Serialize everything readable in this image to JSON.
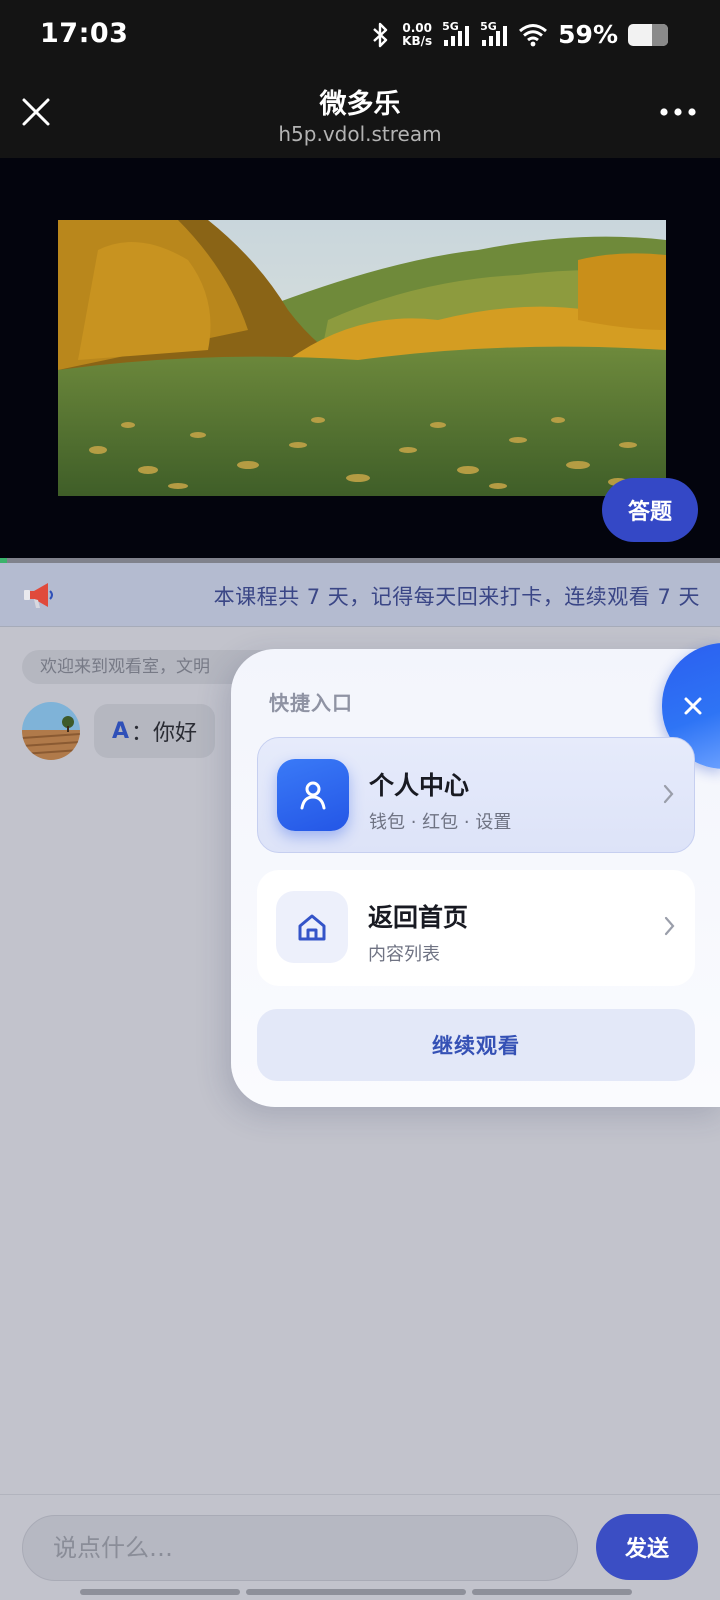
{
  "status_bar": {
    "time": "17:03",
    "net_speed_value": "0.00",
    "net_speed_unit": "KB/s",
    "signal1_tag": "5G",
    "signal2_tag": "5G",
    "battery": "59%",
    "battery_level": 0.59,
    "icons": [
      "bluetooth-icon",
      "signal-icon",
      "wifi-icon",
      "battery-icon"
    ]
  },
  "title_bar": {
    "title": "微多乐",
    "url": "h5p.vdol.stream"
  },
  "video": {
    "answer_button": "答题",
    "progress": 0.01
  },
  "notice": {
    "text": "本课程共 7 天，记得每天回来打卡，连续观看 7 天"
  },
  "chat": {
    "welcome": "欢迎来到观看室，文明",
    "messages": [
      {
        "sender": "A",
        "separator": "：",
        "text": "你好"
      }
    ]
  },
  "quick_panel": {
    "title": "快捷入口",
    "cards": [
      {
        "title": "个人中心",
        "subtitle": "钱包 · 红包 · 设置",
        "icon": "user-icon"
      },
      {
        "title": "返回首页",
        "subtitle": "内容列表",
        "icon": "home-icon"
      }
    ],
    "continue_label": "继续观看"
  },
  "input_bar": {
    "placeholder": "说点什么…",
    "send_label": "发送"
  },
  "colors": {
    "accent": "#3448c6",
    "panel_blue": "#2b5ff0",
    "progress_green": "#3bb36c"
  }
}
